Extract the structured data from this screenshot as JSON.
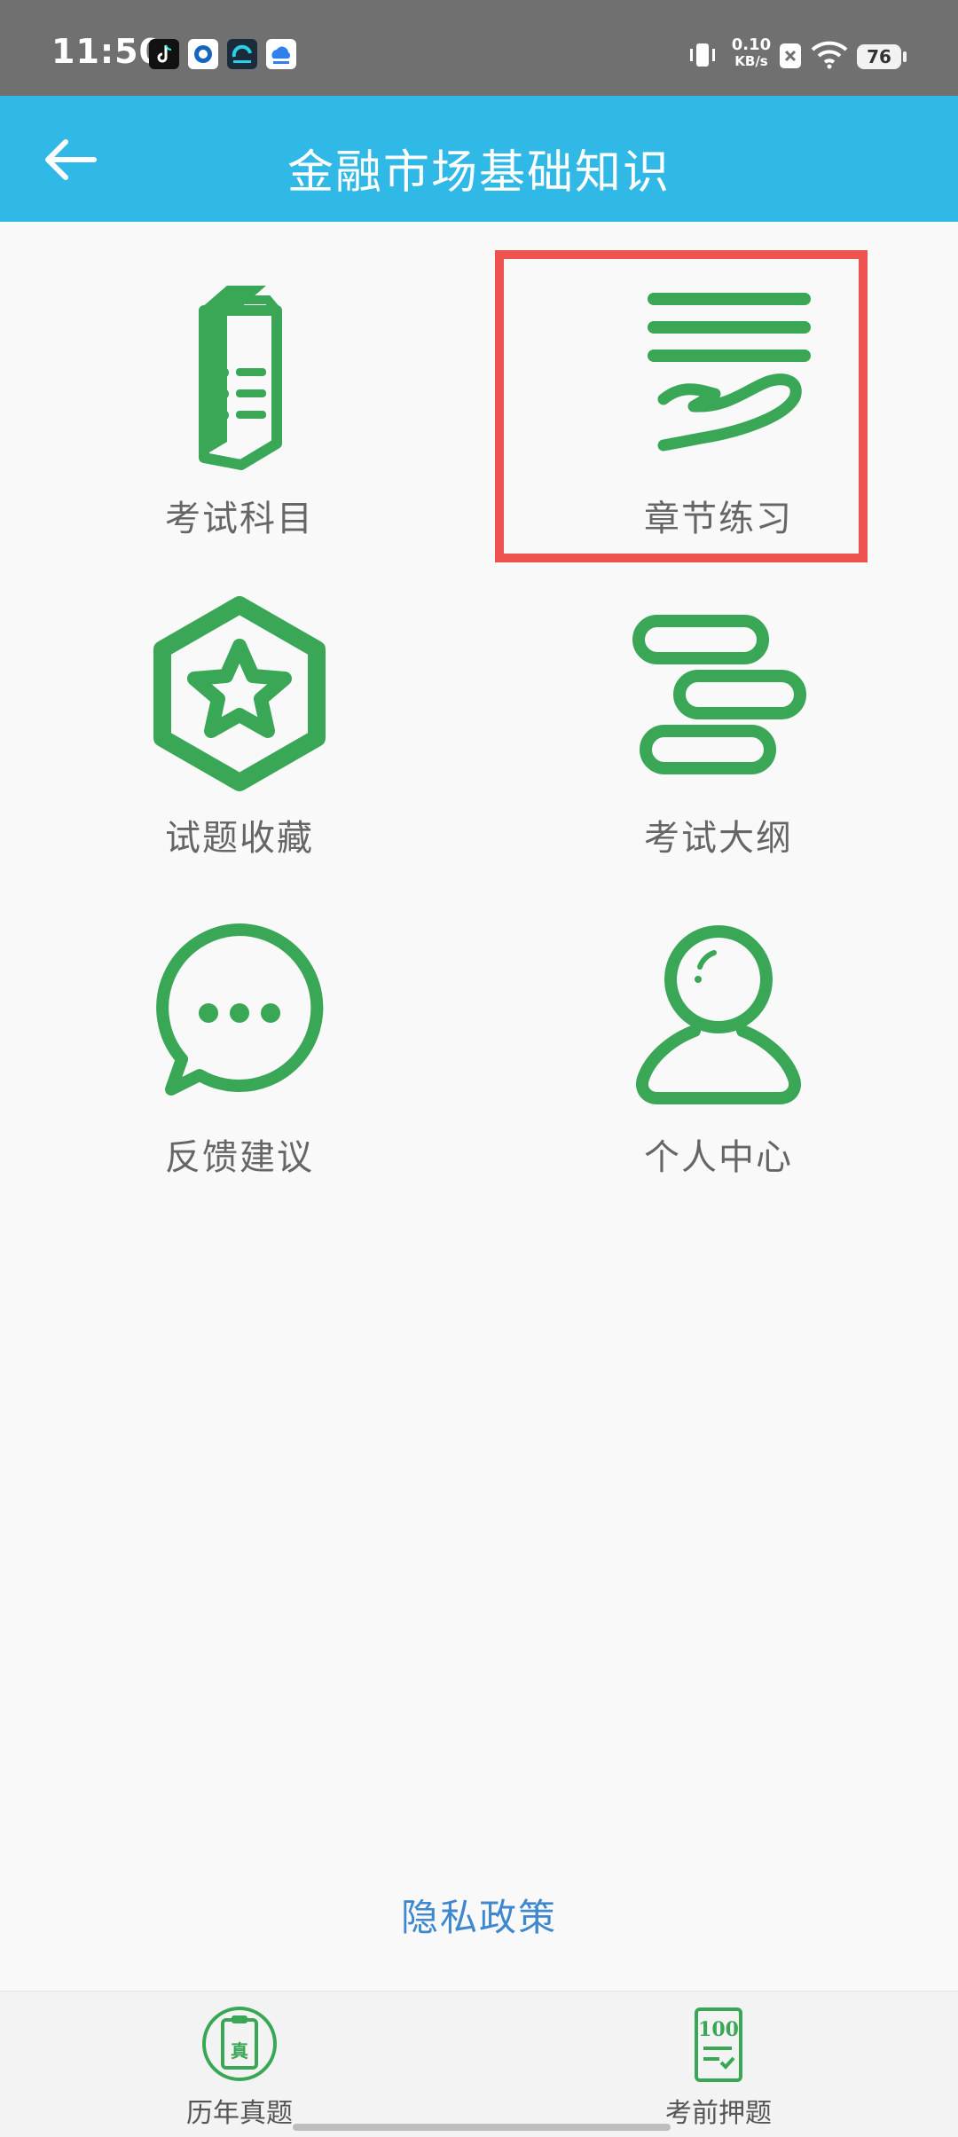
{
  "status_bar": {
    "time": "11:50",
    "network_speed_value": "0.10",
    "network_speed_unit": "KB/s",
    "battery": "76",
    "icons": [
      "tiktok-icon",
      "app-blue-icon",
      "app-cyan-icon",
      "app-cloud-icon",
      "vibrate-icon",
      "sim-off-icon",
      "wifi-icon",
      "battery-icon"
    ]
  },
  "header": {
    "title": "金融市场基础知识",
    "back_icon": "arrow-left-icon"
  },
  "grid": {
    "items": [
      {
        "label": "考试科目",
        "icon": "exam-book-icon"
      },
      {
        "label": "章节练习",
        "icon": "chapter-practice-icon"
      },
      {
        "label": "试题收藏",
        "icon": "star-hexagon-icon"
      },
      {
        "label": "考试大纲",
        "icon": "outline-icon"
      },
      {
        "label": "反馈建议",
        "icon": "chat-bubble-icon"
      },
      {
        "label": "个人中心",
        "icon": "user-icon"
      }
    ]
  },
  "privacy_link": "隐私政策",
  "bottom_nav": {
    "items": [
      {
        "label": "历年真题",
        "icon": "past-papers-icon",
        "badge_char": "真"
      },
      {
        "label": "考前押题",
        "icon": "score-100-icon",
        "badge_text": "100"
      }
    ]
  },
  "colors": {
    "header": "#30b8e6",
    "icon_green": "#3aa757",
    "highlight": "#ef5350",
    "link": "#3f88cf"
  }
}
